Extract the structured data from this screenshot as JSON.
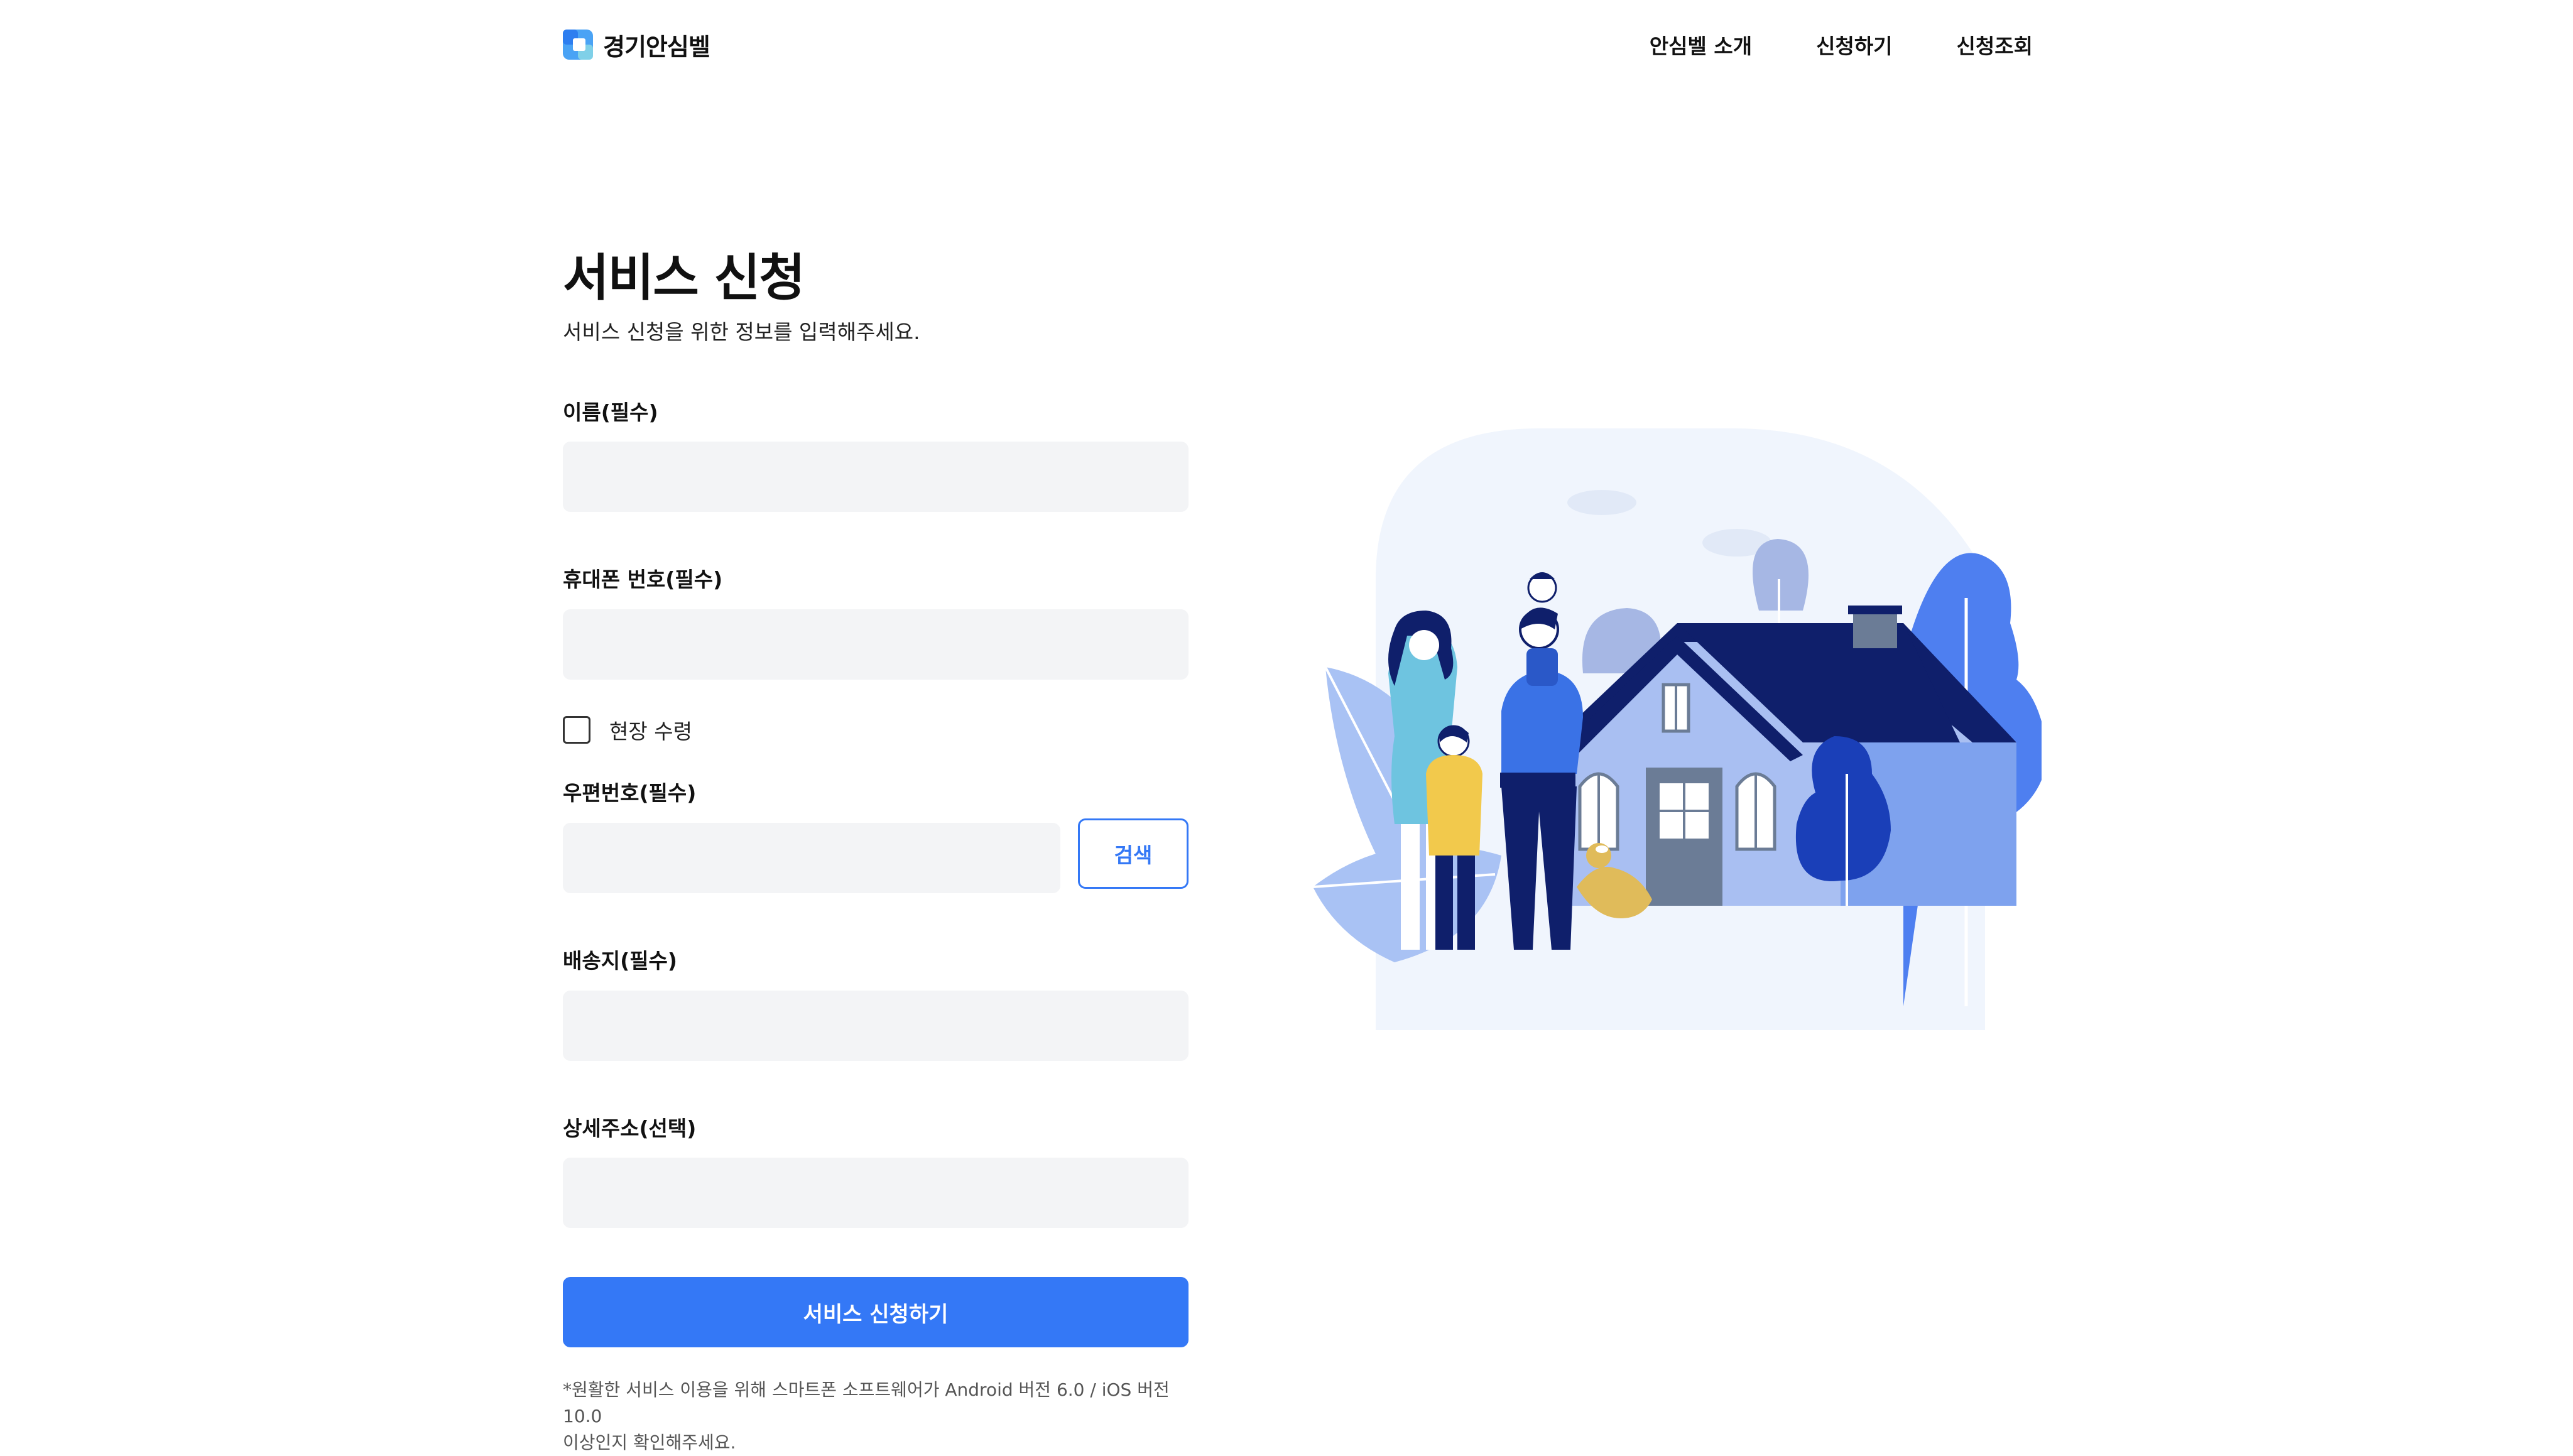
{
  "header": {
    "brand_name": "경기안심벨",
    "nav": [
      "안심벨 소개",
      "신청하기",
      "신청조회"
    ]
  },
  "page": {
    "title": "서비스 신청",
    "subtitle": "서비스 신청을 위한 정보를 입력해주세요."
  },
  "form": {
    "name_label": "이름(필수)",
    "phone_label": "휴대폰 번호(필수)",
    "onsite_label": "현장 수령",
    "onsite_checked": false,
    "postcode_label": "우편번호(필수)",
    "search_label": "검색",
    "address_label": "배송지(필수)",
    "detail_label": "상세주소(선택)",
    "name_value": "",
    "phone_value": "",
    "postcode_value": "",
    "address_value": "",
    "detail_value": "",
    "submit_label": "서비스 신청하기"
  },
  "note_lines": [
    "*원활한 서비스 이용을 위해 스마트폰 소프트웨어가 Android 버전 6.0 / iOS 버전 10.0",
    "이상인지 확인해주세요."
  ],
  "colors": {
    "accent": "#3478f6",
    "input_bg": "#f3f4f6",
    "illustration_bg": "#f0f5fd",
    "house_roof": "#0f1f6b",
    "house_wall": "#a9bff2"
  },
  "icons": [
    "logo-icon",
    "family-house-illustration"
  ]
}
